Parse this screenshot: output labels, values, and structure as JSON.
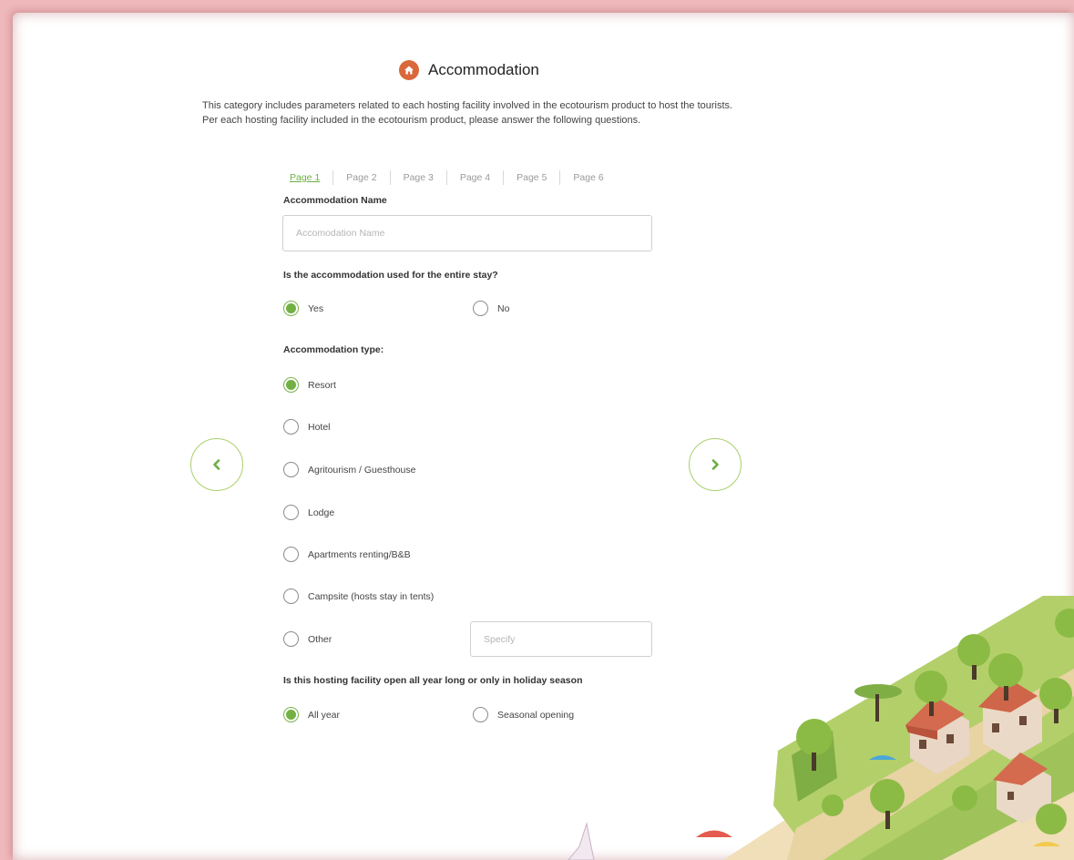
{
  "header": {
    "title": "Accommodation",
    "icon": "home-icon",
    "icon_color": "#d9683a",
    "intro": "This category includes parameters related to each hosting facility involved in the ecotourism product to host the tourists. Per each hosting facility included in the ecotourism product, please answer the following questions."
  },
  "tabs": [
    {
      "label": "Page 1",
      "active": true
    },
    {
      "label": "Page 2"
    },
    {
      "label": "Page 3"
    },
    {
      "label": "Page 4"
    },
    {
      "label": "Page 5"
    },
    {
      "label": "Page 6"
    }
  ],
  "form": {
    "name_label": "Accommodation Name",
    "name_value": "",
    "name_placeholder": "Accomodation Name",
    "entire_stay_question": "Is the accommodation used for the entire stay?",
    "entire_stay_options": [
      {
        "label": "Yes",
        "checked": true
      },
      {
        "label": "No",
        "checked": false
      }
    ],
    "type_label": "Accommodation type:",
    "type_options": [
      {
        "label": "Resort",
        "checked": true
      },
      {
        "label": "Hotel",
        "checked": false
      },
      {
        "label": "Agritourism / Guesthouse",
        "checked": false
      },
      {
        "label": "Lodge",
        "checked": false
      },
      {
        "label": "Apartments renting/B&B",
        "checked": false
      },
      {
        "label": "Campsite (hosts stay in tents)",
        "checked": false
      },
      {
        "label": "Other",
        "checked": false
      }
    ],
    "specify_placeholder": "Specify",
    "season_question": "Is this hosting facility open all year long or only in holiday season",
    "season_options": [
      {
        "label": "All year",
        "checked": true
      },
      {
        "label": "Seasonal opening",
        "checked": false
      }
    ]
  },
  "nav": {
    "prev_icon": "chevron-left-icon",
    "next_icon": "chevron-right-icon"
  },
  "colors": {
    "accent_green": "#72b043",
    "border_pink": "#efb8bb"
  }
}
